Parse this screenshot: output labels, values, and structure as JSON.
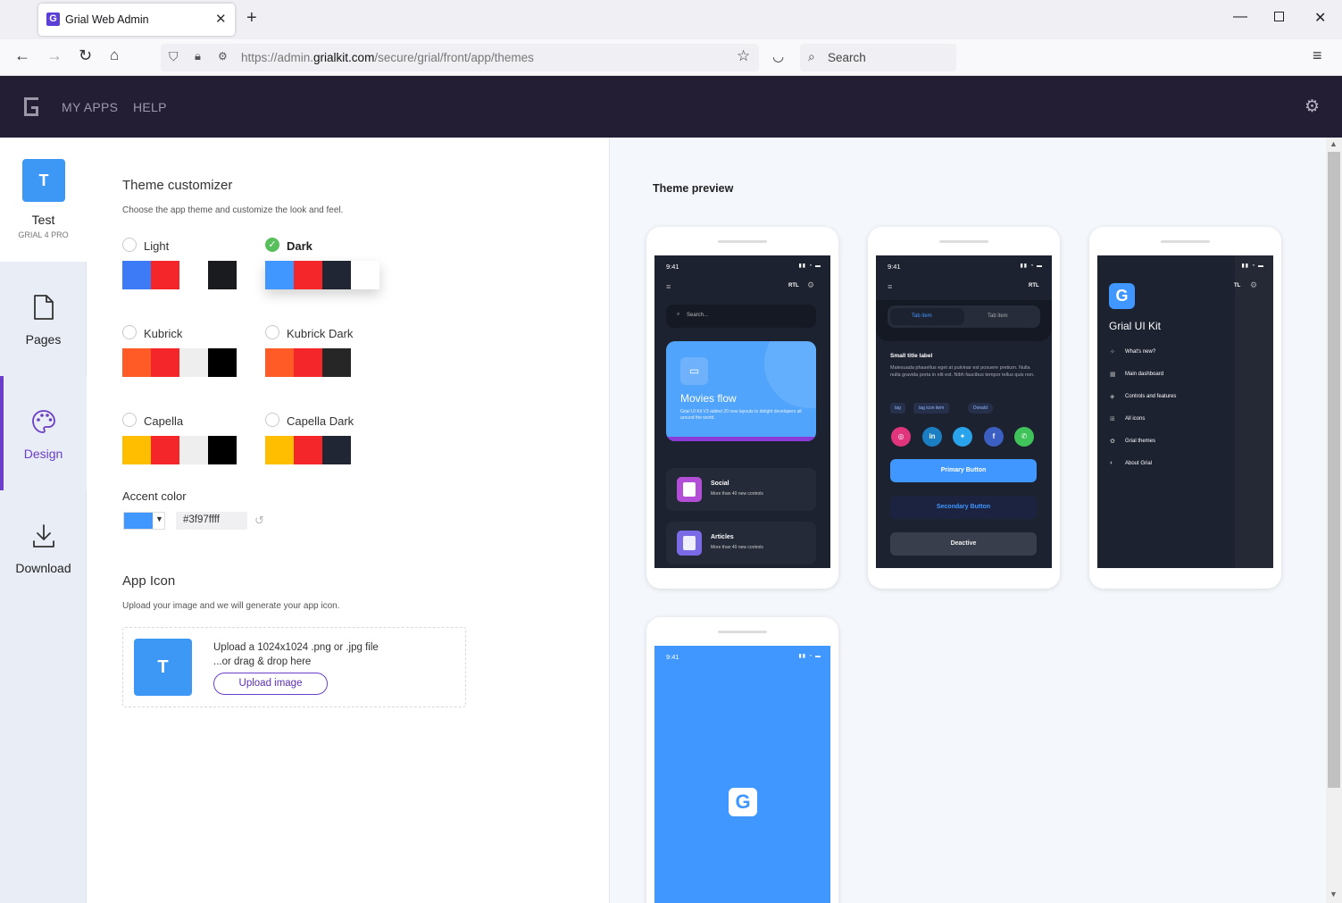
{
  "browser": {
    "tab_title": "Grial Web Admin",
    "tab_favicon_letter": "G",
    "url_prefix": "https://admin.",
    "url_domain": "grialkit.com",
    "url_path": "/secure/grial/front/app/themes",
    "search_placeholder": "Search"
  },
  "header": {
    "menu": [
      "MY APPS",
      "HELP"
    ]
  },
  "sidebar": {
    "app": {
      "tile_letter": "T",
      "name": "Test",
      "subtitle": "GRIAL 4 PRO"
    },
    "items": [
      {
        "label": "Pages",
        "icon": "page-icon"
      },
      {
        "label": "Design",
        "icon": "palette-icon",
        "active": true
      },
      {
        "label": "Download",
        "icon": "download-icon"
      }
    ]
  },
  "customizer": {
    "title": "Theme customizer",
    "subtitle": "Choose the app theme and customize the look and feel.",
    "themes": [
      {
        "label": "Light",
        "selected": false,
        "colors": [
          "#3d7af5",
          "#f5262a",
          "#ffffff",
          "#1a1b1f"
        ]
      },
      {
        "label": "Dark",
        "selected": true,
        "colors": [
          "#3f97ff",
          "#f5262a",
          "#212634",
          "#ffffff"
        ]
      },
      {
        "label": "Kubrick",
        "selected": false,
        "colors": [
          "#ff5b26",
          "#f5262a",
          "#eeeeee",
          "#000000"
        ]
      },
      {
        "label": "Kubrick Dark",
        "selected": false,
        "colors": [
          "#ff5b26",
          "#f5262a",
          "#262626",
          "#ffffff"
        ]
      },
      {
        "label": "Capella",
        "selected": false,
        "colors": [
          "#ffbf00",
          "#f5262a",
          "#eeeeee",
          "#000000"
        ]
      },
      {
        "label": "Capella Dark",
        "selected": false,
        "colors": [
          "#ffbf00",
          "#f5262a",
          "#212634",
          "#ffffff"
        ]
      }
    ],
    "accent": {
      "label": "Accent color",
      "value": "#3f97ffff",
      "color": "#3f97ff"
    },
    "app_icon": {
      "title": "App Icon",
      "subtitle": "Upload your image and we will generate your app icon.",
      "tile_letter": "T",
      "line1": "Upload a 1024x1024 .png or .jpg file",
      "line2": "...or drag & drop here",
      "button": "Upload image"
    }
  },
  "preview": {
    "title": "Theme preview",
    "phone1": {
      "time": "9:41",
      "rtl": "RTL",
      "search": "Search...",
      "card_title": "Movies flow",
      "card_text": "Grial UI Kit V3 added 20 new layouts to delight developers all around the world.",
      "items": [
        {
          "title": "Social",
          "sub": "More than 40 new controls"
        },
        {
          "title": "Articles",
          "sub": "More than 40 new controls"
        }
      ]
    },
    "phone2": {
      "time": "9:41",
      "rtl": "RTL",
      "tabs": [
        "Tab item",
        "Tab item"
      ],
      "small_title": "Small title label",
      "body": "Malesuada phasellus eget at pulvinar est posuere pretium. Nulla nulla gravida porta in elit est. Nibh faucibus tempor tellus quis non.",
      "tags": [
        "tag",
        "tag icon item",
        "Donald"
      ],
      "primary": "Primary Button",
      "secondary": "Secondary Button",
      "deactive": "Deactive"
    },
    "phone3": {
      "rtl": "TL",
      "brand": "Grial UI Kit",
      "menu": [
        "What's new?",
        "Main dashboard",
        "Controls and features",
        "All icons",
        "Grial themes",
        "About Grial"
      ]
    },
    "phone4": {
      "time": "9:41"
    }
  }
}
